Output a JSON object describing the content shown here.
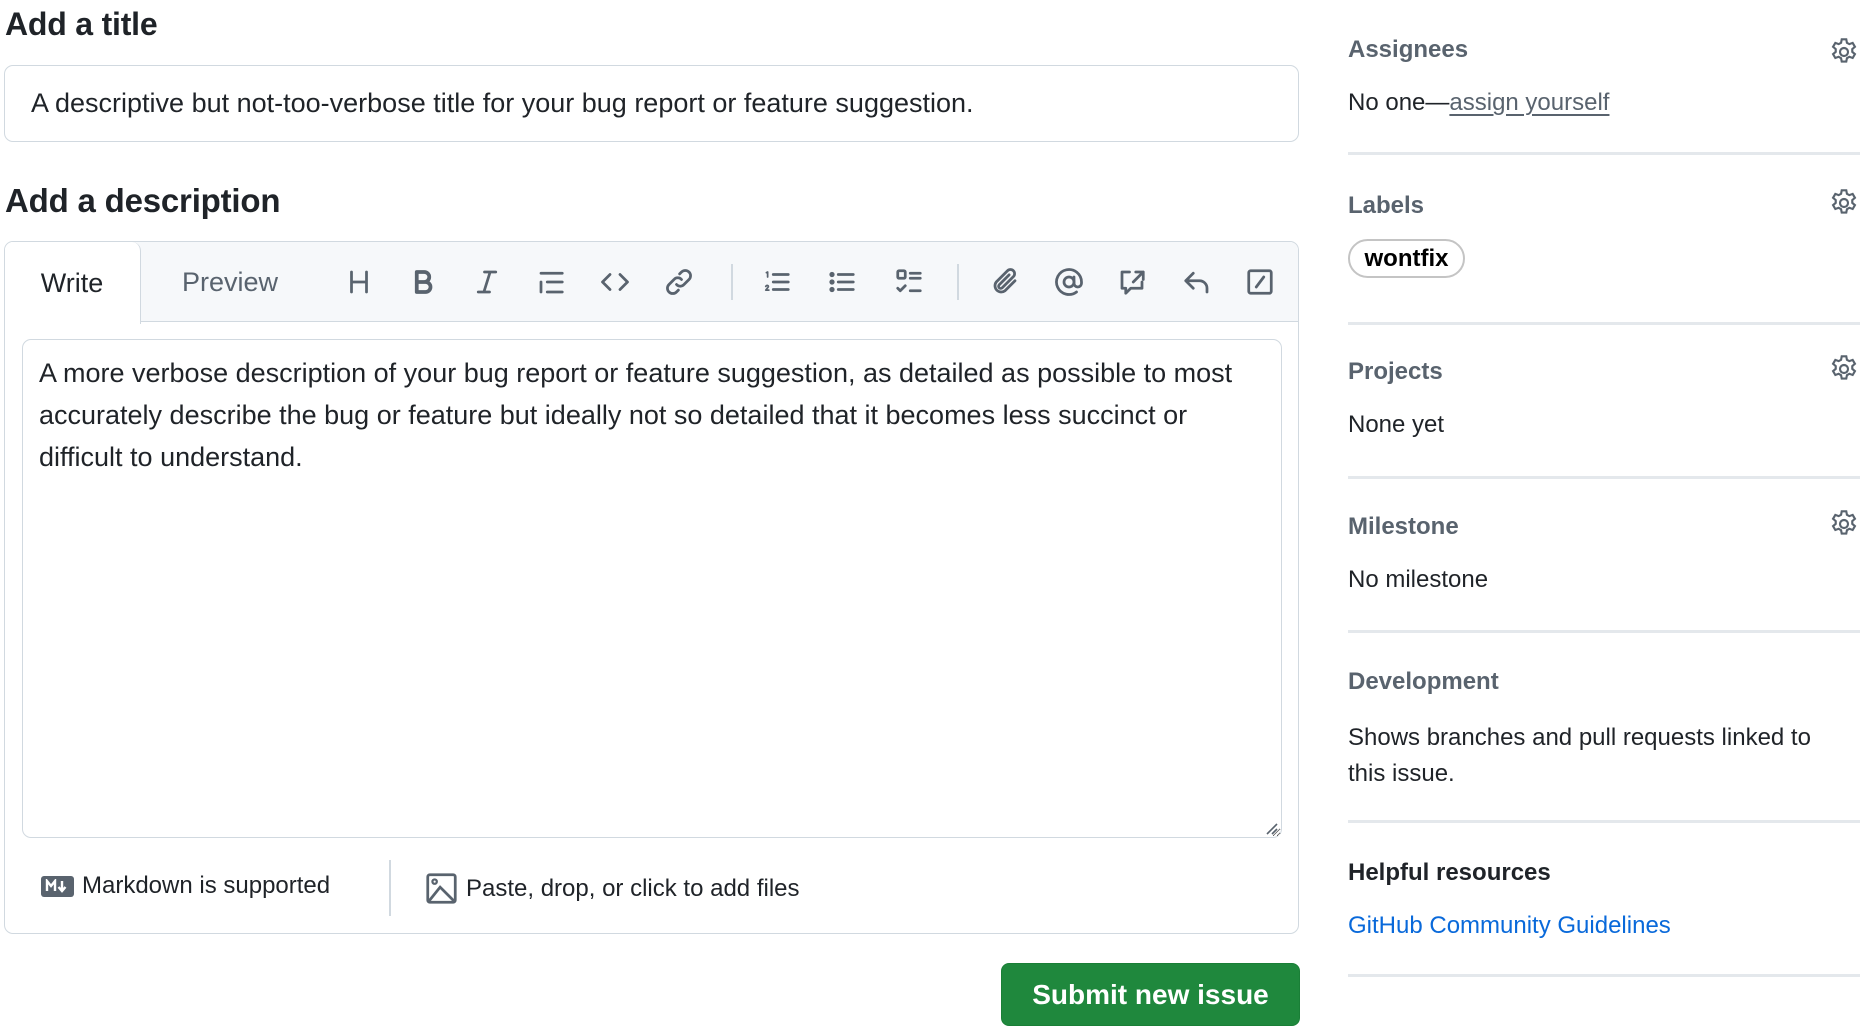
{
  "title_section": {
    "heading": "Add a title",
    "input_value": "A descriptive but not-too-verbose title for your bug report or feature suggestion."
  },
  "description_section": {
    "heading": "Add a description",
    "tabs": [
      {
        "label": "Write",
        "active": true
      },
      {
        "label": "Preview",
        "active": false
      }
    ],
    "toolbar": [
      {
        "icon": "heading-icon",
        "label": "Heading"
      },
      {
        "icon": "bold-icon",
        "label": "Bold"
      },
      {
        "icon": "italic-icon",
        "label": "Italic"
      },
      {
        "icon": "quote-icon",
        "label": "Quote"
      },
      {
        "icon": "code-icon",
        "label": "Code"
      },
      {
        "icon": "link-icon",
        "label": "Link"
      },
      {
        "icon": "ordered-list-icon",
        "label": "Numbered list"
      },
      {
        "icon": "unordered-list-icon",
        "label": "Unordered list"
      },
      {
        "icon": "task-list-icon",
        "label": "Task list"
      },
      {
        "icon": "paperclip-icon",
        "label": "Attach files"
      },
      {
        "icon": "mention-icon",
        "label": "Mention"
      },
      {
        "icon": "cross-reference-icon",
        "label": "Reference"
      },
      {
        "icon": "saved-reply-icon",
        "label": "Saved replies"
      },
      {
        "icon": "slash-commands-icon",
        "label": "Slash commands"
      }
    ],
    "body_value": "A more verbose description of your bug report or feature suggestion, as detailed as possible to most accurately describe the bug or feature but ideally not so detailed that it becomes less succinct or difficult to understand.",
    "footer": {
      "markdown_note": "Markdown is supported",
      "files_note": "Paste, drop, or click to add files"
    }
  },
  "submit_button": {
    "label": "Submit new issue",
    "color": "#1f883d"
  },
  "sidebar": {
    "assignees": {
      "heading": "Assignees",
      "prefix": "No one—",
      "link": "assign yourself"
    },
    "labels": {
      "heading": "Labels",
      "items": [
        "wontfix"
      ]
    },
    "projects": {
      "heading": "Projects",
      "value": "None yet"
    },
    "milestone": {
      "heading": "Milestone",
      "value": "No milestone"
    },
    "development": {
      "heading": "Development",
      "value": "Shows branches and pull requests linked to this issue."
    },
    "helpful_resources": {
      "heading": "Helpful resources",
      "links": [
        "GitHub Community Guidelines"
      ],
      "link_color": "#0969da"
    }
  }
}
